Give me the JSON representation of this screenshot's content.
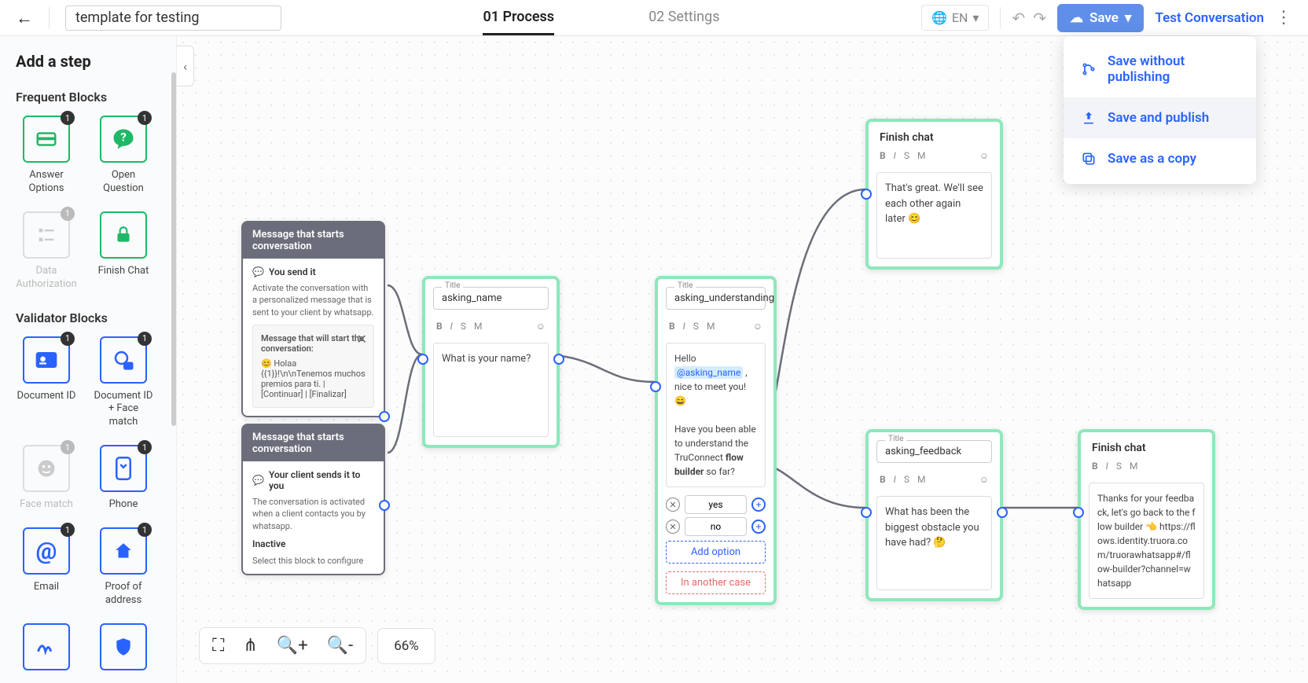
{
  "header": {
    "template_name": "template for testing",
    "tabs": {
      "process": "01 Process",
      "settings": "02 Settings"
    },
    "lang": "EN",
    "save": "Save",
    "test": "Test Conversation"
  },
  "save_menu": {
    "without_publish": "Save without publishing",
    "and_publish": "Save and publish",
    "as_copy": "Save as a copy"
  },
  "sidebar": {
    "title": "Add a step",
    "section_frequent": "Frequent Blocks",
    "section_validator": "Validator Blocks",
    "blocks": {
      "answer_options": "Answer Options",
      "open_question": "Open Question",
      "data_authorization": "Data Authorization",
      "finish_chat": "Finish Chat",
      "document_id": "Document ID",
      "document_id_face": "Document ID + Face match",
      "face_match": "Face match",
      "phone": "Phone",
      "email": "Email",
      "proof_address": "Proof of address"
    }
  },
  "canvas": {
    "zoom": "66%",
    "node_start_send": {
      "header": "Message that starts conversation",
      "sub": "You send it",
      "desc": "Activate the conversation with a personalized message that is sent to your client by whatsapp.",
      "inner_title": "Message that will start the conversation:",
      "inner_body": "😊 Holaa {{1}}!\\n\\nTenemos muchos premios para ti. | [Continuar] | [Finalizar]"
    },
    "node_start_receive": {
      "header": "Message that starts conversation",
      "sub": "Your client sends it to you",
      "desc": "The conversation is activated when a client contacts you by whatsapp.",
      "status": "Inactive",
      "hint": "Select this block to configure"
    },
    "node_asking_name": {
      "title_label": "Title",
      "title": "asking_name",
      "msg": "What is your name?"
    },
    "node_asking_understanding": {
      "title_label": "Title",
      "title": "asking_understanding",
      "msg_pre": "Hello ",
      "msg_mention": "@asking_name",
      "msg_post": " , nice to meet you! 😄",
      "msg_q": "Have you been able to understand the TruConnect ",
      "msg_bold": "flow builder",
      "msg_tail": " so far?",
      "opt_yes": "yes",
      "opt_no": "no",
      "add_option": "Add option",
      "another_case": "In another case"
    },
    "node_finish_great": {
      "title": "Finish chat",
      "msg": "That's great. We'll see each other again later 😊"
    },
    "node_asking_feedback": {
      "title_label": "Title",
      "title": "asking_feedback",
      "msg": "What has been the biggest obstacle you have had? 🤔"
    },
    "node_finish_thanks": {
      "title": "Finish chat",
      "msg": "Thanks for your feedback, let's go back to the flow builder 👈 https://flows.identity.truora.com/truorawhatsapp#/flow-builder?channel=whatsapp"
    }
  }
}
